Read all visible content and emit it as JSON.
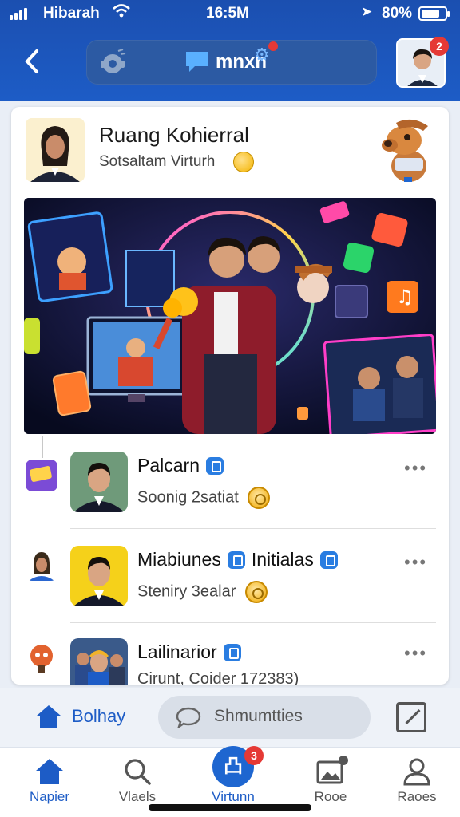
{
  "status_bar": {
    "carrier": "Hibarah",
    "time": "16:5M",
    "battery": "80%",
    "battery_level": 0.8
  },
  "header": {
    "back_icon": "chevron-left-icon",
    "brand": "mnxn",
    "avatar_badge": "2"
  },
  "room": {
    "title": "Ruang Kohierral",
    "subtitle": "Sotsaltam Virturh"
  },
  "feed": [
    {
      "name": "Palcarn",
      "extra_name": "",
      "sub": "Soonig 2satiat"
    },
    {
      "name": "Miabiunes",
      "extra_name": "Initialas",
      "sub": "Steniry 3ealar"
    },
    {
      "name": "Lailinarior",
      "extra_name": "",
      "sub": "Cirunt, Coider 172383)"
    }
  ],
  "compose": {
    "home_label": "Bolhay",
    "input_placeholder": "Shmumtties"
  },
  "bottom_nav": [
    {
      "label": "Napier",
      "icon": "home-icon",
      "active": true
    },
    {
      "label": "Vlaels",
      "icon": "search-icon",
      "active": false
    },
    {
      "label": "Virtunn",
      "icon": "create-icon",
      "active": false,
      "badge": "3"
    },
    {
      "label": "Rooe",
      "icon": "image-icon",
      "active": false
    },
    {
      "label": "Raoes",
      "icon": "profile-icon",
      "active": false
    }
  ],
  "colors": {
    "header_blue": "#1d5cc6",
    "accent_blue": "#1e66d0",
    "badge_red": "#e53935"
  }
}
